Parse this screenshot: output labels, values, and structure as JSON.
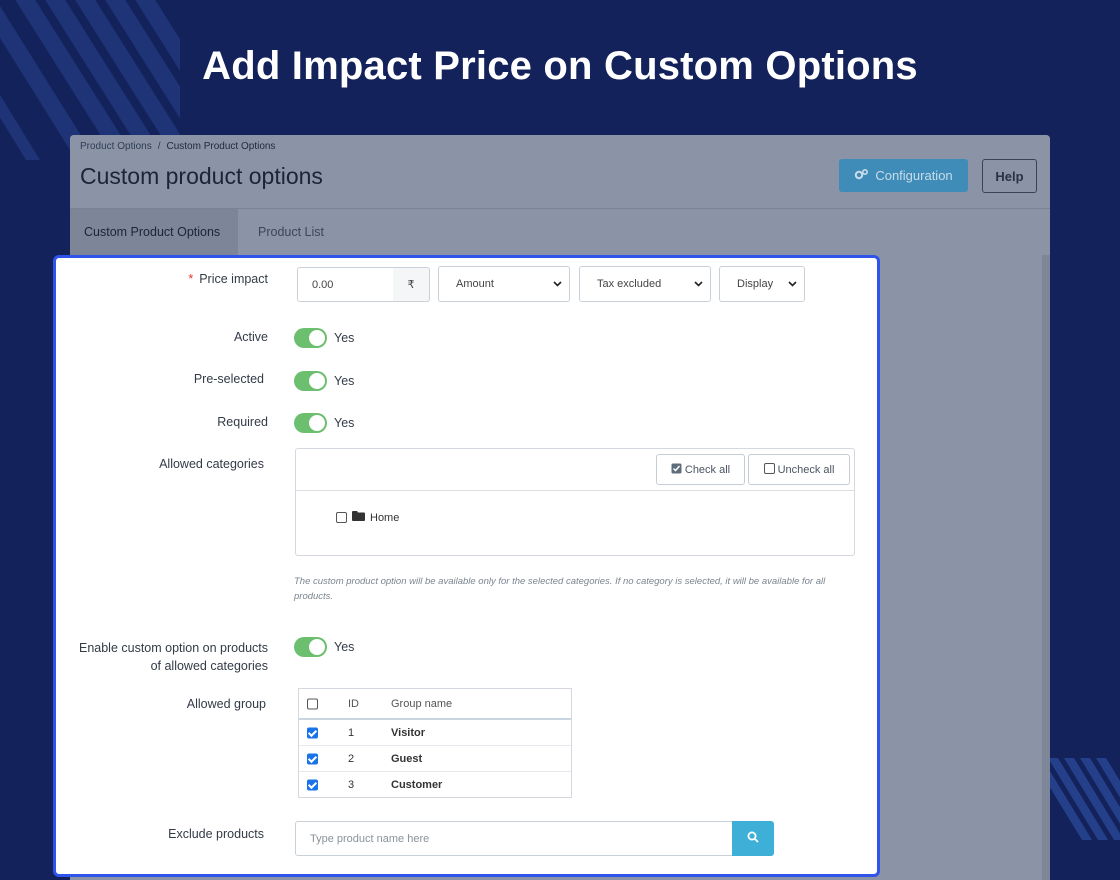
{
  "hero": {
    "title": "Add Impact Price on Custom Options"
  },
  "admin": {
    "breadcrumb": [
      "Product Options",
      "Custom Product Options"
    ],
    "breadcrumb_sep": "/",
    "page_title": "Custom product options",
    "config_button": "Configuration",
    "help_button": "Help",
    "tabs": [
      "Custom Product Options",
      "Product List"
    ]
  },
  "form": {
    "price_impact": {
      "label": "Price impact",
      "required_marker": "*",
      "value": "0.00",
      "currency": "₹",
      "type_select": "Amount",
      "tax_select": "Tax excluded",
      "display_select": "Display"
    },
    "active": {
      "label": "Active",
      "value": "Yes"
    },
    "preselected": {
      "label": "Pre-selected",
      "value": "Yes"
    },
    "required": {
      "label": "Required",
      "value": "Yes"
    },
    "allowed_categories": {
      "label": "Allowed categories",
      "check_all": "Check all",
      "uncheck_all": "Uncheck all",
      "tree": [
        "Home"
      ],
      "help": "The custom product option will be available only for the selected categories. If no category is selected, it will be available for all products."
    },
    "enable_on_allowed": {
      "label_line1": "Enable custom option on products",
      "label_line2": "of allowed categories",
      "value": "Yes"
    },
    "allowed_group": {
      "label": "Allowed group",
      "columns": [
        "ID",
        "Group name"
      ],
      "rows": [
        {
          "id": "1",
          "name": "Visitor",
          "checked": true
        },
        {
          "id": "2",
          "name": "Guest",
          "checked": true
        },
        {
          "id": "3",
          "name": "Customer",
          "checked": true
        }
      ]
    },
    "exclude_products": {
      "label": "Exclude products",
      "placeholder": "Type product name here"
    }
  },
  "colors": {
    "background": "#13225a",
    "accent_border": "#2f54eb",
    "toggle_on": "#6bbf6e",
    "search_button": "#3eb0d7",
    "checkbox_checked": "#1a73e8"
  }
}
